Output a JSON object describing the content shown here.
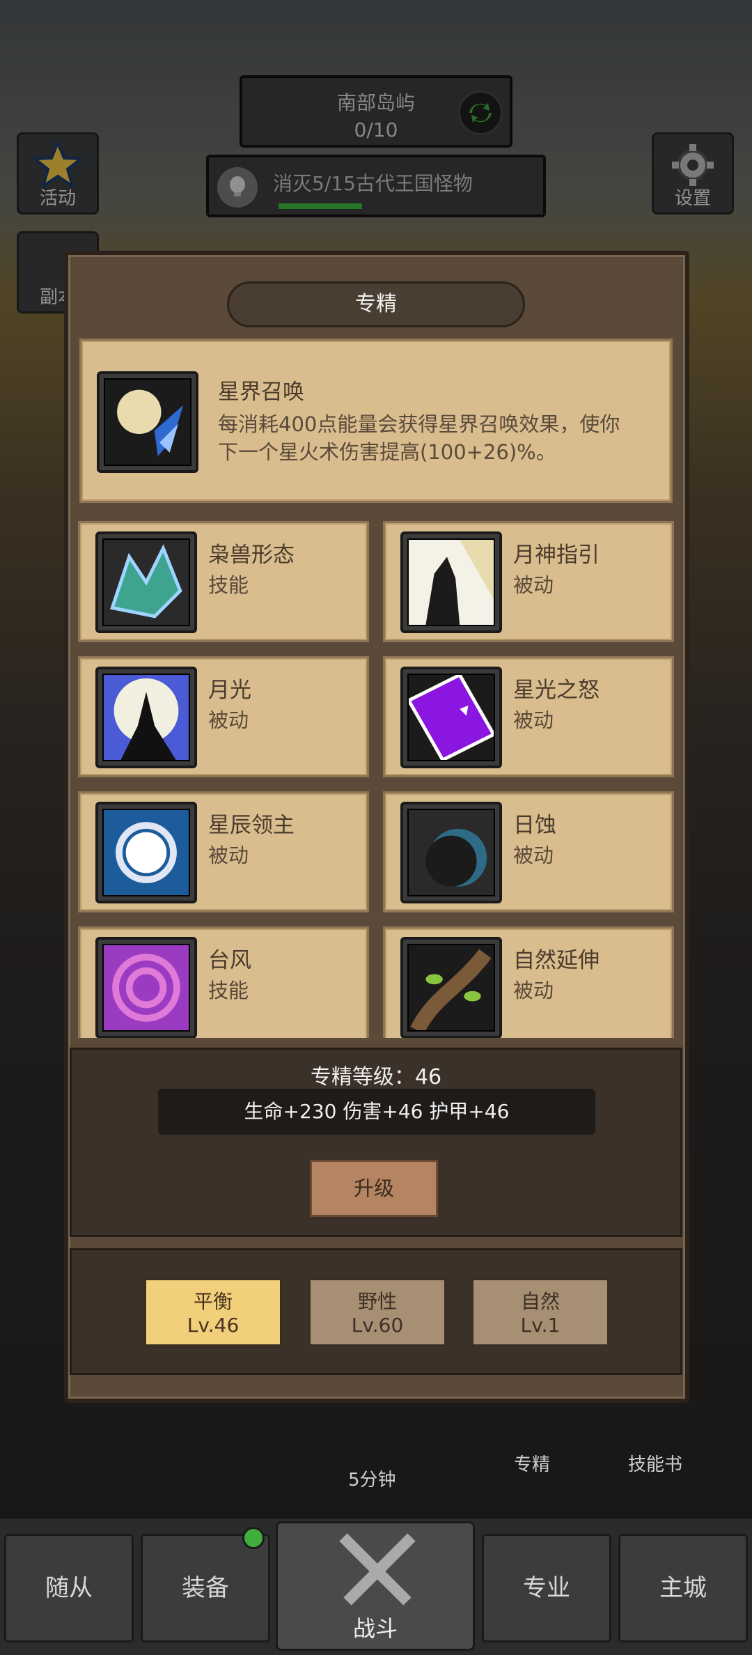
{
  "top": {
    "region_name": "南部岛屿",
    "region_progress": "0/10",
    "quest_text": "消灭5/15古代王国怪物",
    "quest_progress": 0.33,
    "left_buttons": [
      {
        "label": "活动",
        "icon": "star-icon"
      },
      {
        "label": "副本",
        "icon": "gate-icon"
      }
    ],
    "settings_label": "设置"
  },
  "panel": {
    "title": "专精",
    "featured": {
      "name": "星界召唤",
      "desc_line1": "每消耗400点能量会获得星界召唤效果，使你",
      "desc_line2": "下一个星火术伤害提高(100+26)%。",
      "icon": "moon-comet-icon"
    },
    "skills": [
      {
        "name": "枭兽形态",
        "type": "技能",
        "icon": "owlbeast-icon"
      },
      {
        "name": "月神指引",
        "type": "被动",
        "icon": "moon-guide-icon"
      },
      {
        "name": "月光",
        "type": "被动",
        "icon": "moonlight-icon"
      },
      {
        "name": "星光之怒",
        "type": "被动",
        "icon": "starfall-icon"
      },
      {
        "name": "星辰领主",
        "type": "被动",
        "icon": "star-lord-icon"
      },
      {
        "name": "日蚀",
        "type": "被动",
        "icon": "eclipse-icon"
      },
      {
        "name": "台风",
        "type": "技能",
        "icon": "typhoon-icon"
      },
      {
        "name": "自然延伸",
        "type": "被动",
        "icon": "vine-icon"
      }
    ],
    "level_label": "专精等级：46",
    "stats_text": "生命+230  伤害+46  护甲+46",
    "upgrade_label": "升级",
    "tabs": [
      {
        "name": "平衡",
        "level": "Lv.46",
        "active": true
      },
      {
        "name": "野性",
        "level": "Lv.60",
        "active": false
      },
      {
        "name": "自然",
        "level": "Lv.1",
        "active": false
      }
    ]
  },
  "under": {
    "timer": "5分钟",
    "spec": "专精",
    "skillbook": "技能书"
  },
  "nav": {
    "items": [
      "随从",
      "装备",
      "战斗",
      "专业",
      "主城"
    ]
  }
}
